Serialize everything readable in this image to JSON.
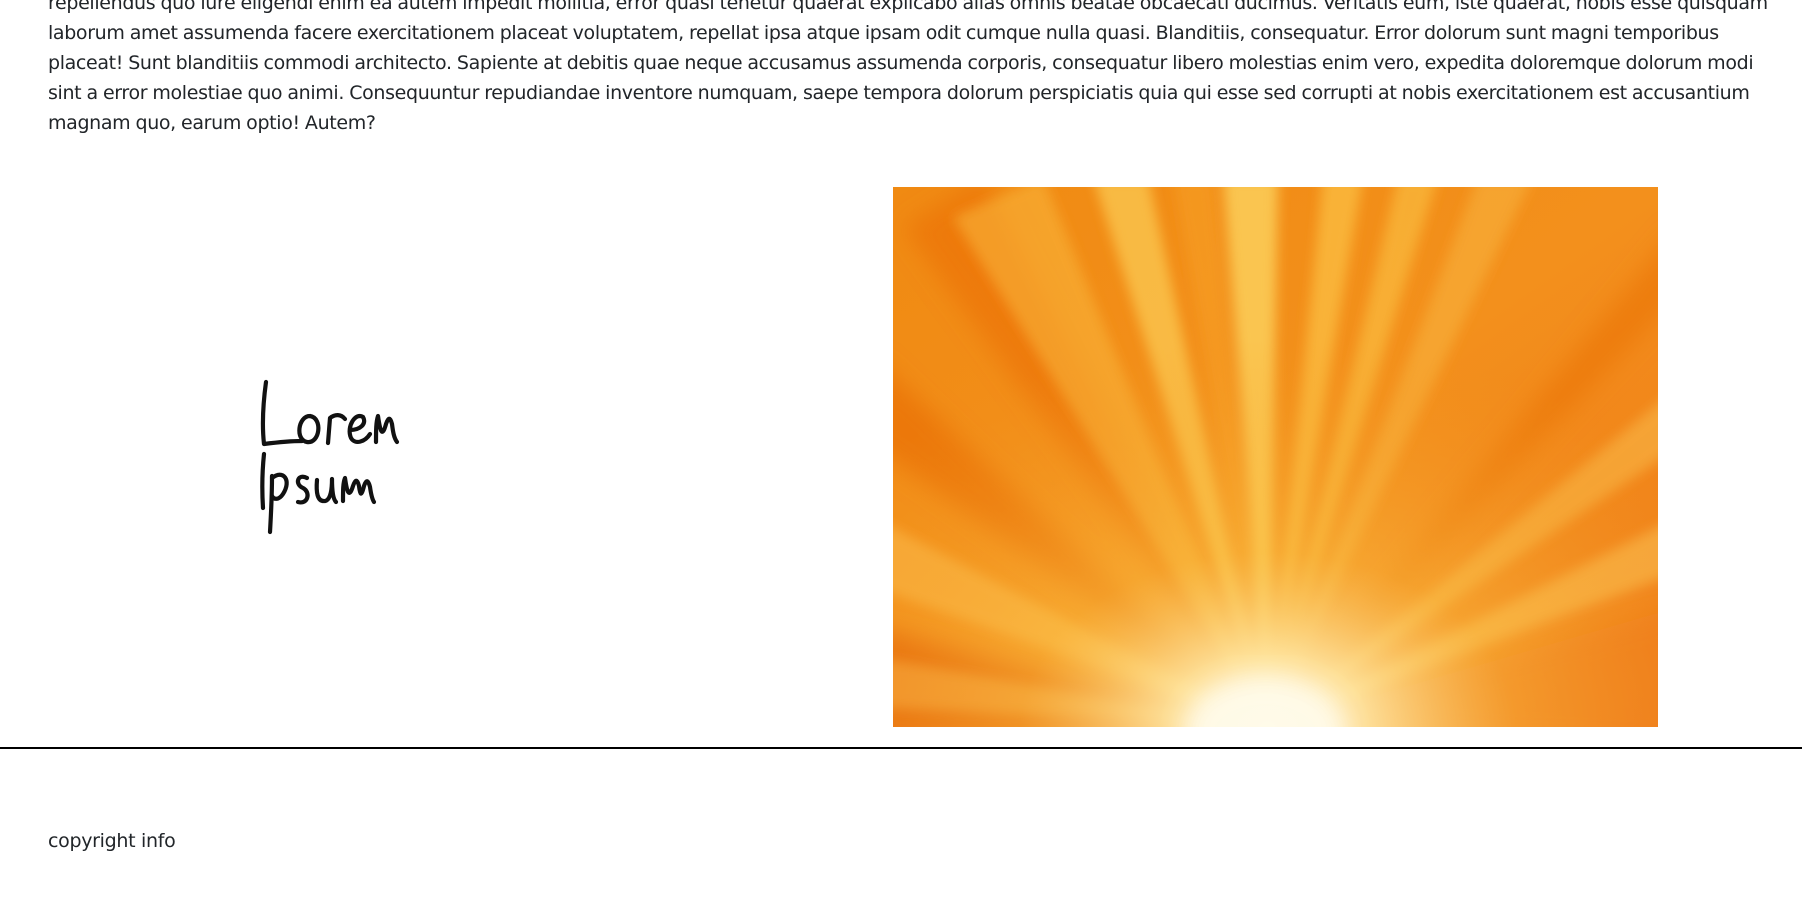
{
  "main": {
    "paragraph": "repellendus quo iure eligendi enim ea autem impedit mollitia, error quasi tenetur quaerat explicabo alias omnis beatae obcaecati ducimus. Veritatis eum, iste quaerat, nobis esse quisquam laborum amet assumenda facere exercitationem placeat voluptatem, repellat ipsa atque ipsam odit cumque nulla quasi. Blanditiis, consequatur. Error dolorum sunt magni temporibus placeat! Sunt blanditiis commodi architecto. Sapiente at debitis quae neque accusamus assumenda corporis, consequatur libero molestias enim vero, expedita doloremque dolorum modi sint a error molestiae quo animi. Consequuntur repudiandae inventore numquam, saepe tempora dolorum perspiciatis quia qui esse sed corrupti at nobis exercitationem est accusantium magnam quo, earum optio! Autem?",
    "logo": {
      "line1": "Lorem",
      "line2": "Ipsum",
      "icon": "handwritten-logo"
    },
    "hero": {
      "icon": "sunburst-image",
      "colors": {
        "deep_orange": "#ee6a0a",
        "orange": "#f5921e",
        "gold": "#fbc94a",
        "light": "#fff6d8"
      }
    }
  },
  "footer": {
    "copyright": "copyright info"
  }
}
